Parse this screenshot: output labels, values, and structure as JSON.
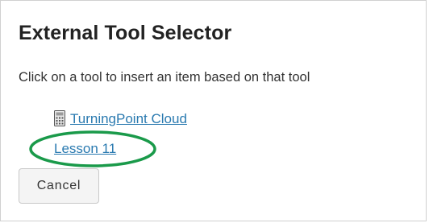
{
  "dialog": {
    "title": "External Tool Selector",
    "instruction": "Click on a tool to insert an item based on that tool"
  },
  "tools": [
    {
      "label": "TurningPoint Cloud",
      "icon": "keypad-icon",
      "has_icon": true
    },
    {
      "label": "Lesson 11",
      "icon": "",
      "has_icon": false,
      "highlighted": true
    }
  ],
  "actions": {
    "cancel_label": "Cancel"
  },
  "colors": {
    "link": "#2a7ab0",
    "highlight_ring": "#1a9a4a",
    "title_text": "#222222",
    "body_text": "#333333"
  }
}
